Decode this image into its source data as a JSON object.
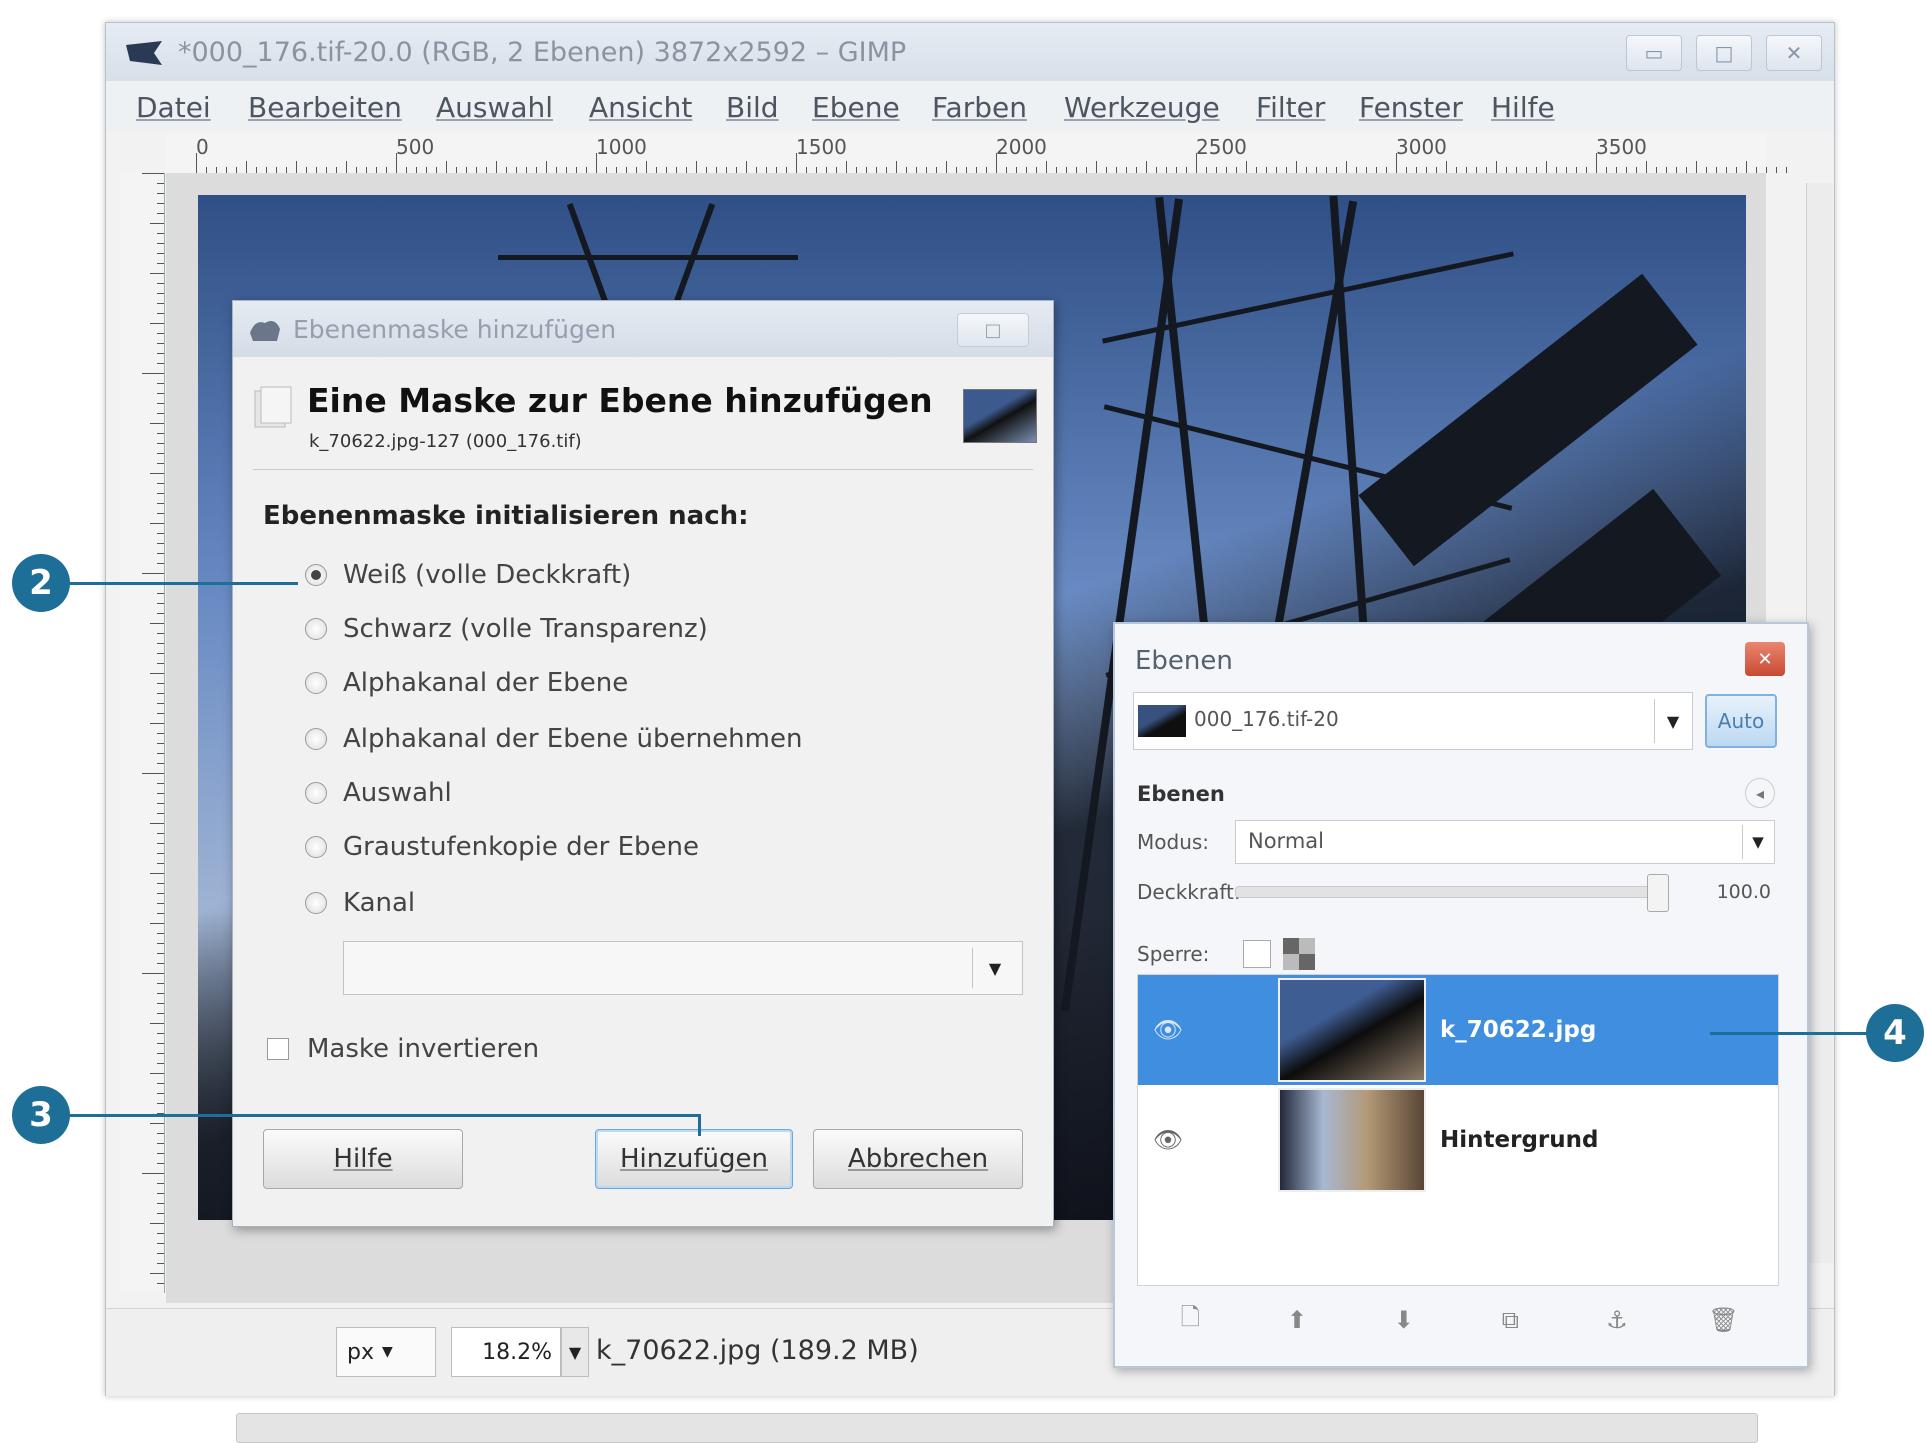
{
  "window": {
    "title": "*000_176.tif-20.0 (RGB, 2 Ebenen) 3872x2592 – GIMP",
    "controls": {
      "minimize": "▭",
      "maximize": "□",
      "close": "✕"
    }
  },
  "menubar": {
    "items": [
      "Datei",
      "Bearbeiten",
      "Auswahl",
      "Ansicht",
      "Bild",
      "Ebene",
      "Farben",
      "Werkzeuge",
      "Filter",
      "Fenster",
      "Hilfe"
    ]
  },
  "ruler": {
    "labels": [
      "0",
      "500",
      "1000",
      "1500",
      "2000",
      "2500",
      "3000",
      "3500"
    ]
  },
  "statusbar": {
    "unit": "px",
    "zoom": "18.2%",
    "info": "k_70622.jpg (189.2 MB)"
  },
  "mask_dialog": {
    "title": "Ebenenmaske hinzufügen",
    "heading": "Eine Maske zur Ebene hinzufügen",
    "subheading": "k_70622.jpg-127 (000_176.tif)",
    "init_label": "Ebenenmaske initialisieren nach:",
    "options": [
      "Weiß (volle Deckkraft)",
      "Schwarz (volle Transparenz)",
      "Alphakanal der Ebene",
      "Alphakanal der Ebene übernehmen",
      "Auswahl",
      "Graustufenkopie der Ebene",
      "Kanal"
    ],
    "selected_option": "Weiß (volle Deckkraft)",
    "channel_value": "",
    "invert_label": "Maske invertieren",
    "invert_checked": false,
    "buttons": {
      "help": "Hilfe",
      "add": "Hinzufügen",
      "cancel": "Abbrechen"
    }
  },
  "layers_dock": {
    "title": "Ebenen",
    "image_name": "000_176.tif-20",
    "auto_label": "Auto",
    "tab_label": "Ebenen",
    "mode_label": "Modus:",
    "mode_value": "Normal",
    "opacity_label": "Deckkraft:",
    "opacity_value": "100.0",
    "opacity_fraction": 1.0,
    "lock_label": "Sperre:",
    "layers": [
      {
        "name": "k_70622.jpg",
        "selected": true
      },
      {
        "name": "Hintergrund",
        "selected": false
      }
    ]
  },
  "callouts": [
    "2",
    "3",
    "4"
  ],
  "colors": {
    "accent": "#1d6f98",
    "selection": "#3f8ee0"
  }
}
